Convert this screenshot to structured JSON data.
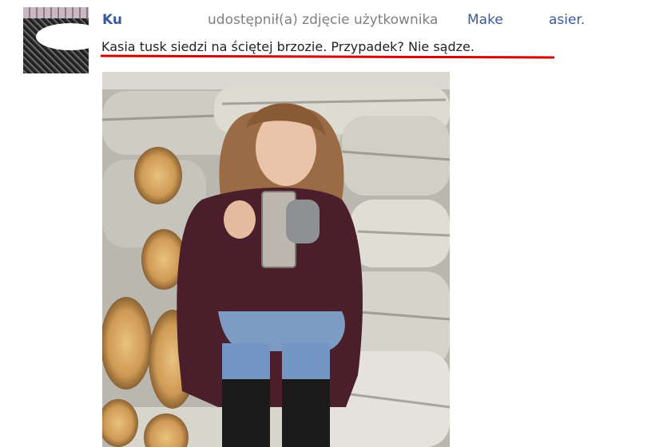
{
  "post": {
    "author_name": "Ku",
    "shared_text": "udostępnił(a) zdjęcie użytkownika",
    "photo_owner_first": "Make",
    "photo_owner_last": "asier.",
    "caption": "Kasia tusk siedzi na ściętej brzozie. Przypadek? Nie sądze.",
    "underline_color": "#d00000",
    "link_color": "#3b5998",
    "muted_color": "#7f7f7f",
    "photo_subject": "woman-sitting-on-birch-logs-photo"
  }
}
